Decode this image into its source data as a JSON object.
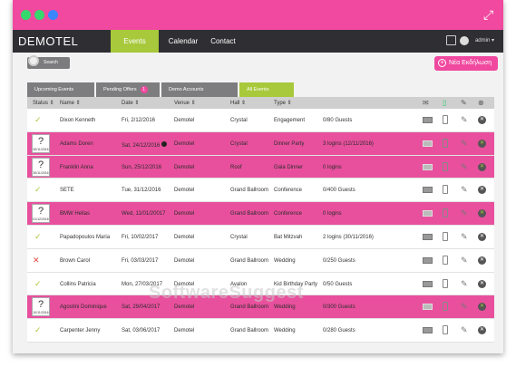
{
  "app": {
    "brand": "DEMOTEL"
  },
  "nav": {
    "tabs": [
      {
        "label": "Events"
      },
      {
        "label": "Calendar"
      },
      {
        "label": "Contact"
      }
    ],
    "user": "admin"
  },
  "toolbar": {
    "search_label": "Search",
    "new_event_label": "Νέα Εκδήλωση"
  },
  "filters": [
    {
      "label": "Upcoming Events"
    },
    {
      "label": "Pending Offers",
      "count": "1"
    },
    {
      "label": "Demo Accounts"
    },
    {
      "label": "All Events"
    }
  ],
  "table": {
    "headers": [
      "Status",
      "Name",
      "Date",
      "Venue",
      "Hall",
      "Type"
    ],
    "rows": [
      {
        "status": "check",
        "name": "Dixon Kenneth",
        "date": "Fri, 2/12/2016",
        "venue": "Demotel",
        "hall": "Crystal",
        "type": "Engagement",
        "guests": "0/80 Guests",
        "pink": false
      },
      {
        "status": "pending",
        "pending_date": "30/11/2016",
        "name": "Adams Doren",
        "date": "Sat, 24/12/2016",
        "venue": "Demotel",
        "hall": "Crystal",
        "type": "Dinner Party",
        "guests": "3 logins (12/11/2016)",
        "pink": true
      },
      {
        "status": "pending",
        "pending_date": "30/11/2016",
        "name": "Franklin Anna",
        "date": "Sun, 25/12/2016",
        "venue": "Demotel",
        "hall": "Roof",
        "type": "Gala Dinner",
        "guests": "0 logins",
        "pink": true
      },
      {
        "status": "check",
        "name": "SETE",
        "date": "Tue, 31/12/2016",
        "venue": "Demotel",
        "hall": "Grand Ballroom",
        "type": "Conference",
        "guests": "0/400 Guests",
        "pink": false
      },
      {
        "status": "pending",
        "pending_date": "01/12/2016",
        "name": "BMW Hellas",
        "date": "Wed, 11/01/20017",
        "venue": "Demotel",
        "hall": "Grand Ballroom",
        "type": "Conference",
        "guests": "0 logins",
        "pink": true
      },
      {
        "status": "check",
        "name": "Papadopoulos Maria",
        "date": "Fri, 10/02/2017",
        "venue": "Demotel",
        "hall": "Crystal",
        "type": "Bat Mitzvah",
        "guests": "2 logins (30/11/2016)",
        "pink": false
      },
      {
        "status": "cross",
        "name": "Brown Carol",
        "date": "Fri, 03/03/2017",
        "venue": "Demotel",
        "hall": "Grand Ballroom",
        "type": "Wedding",
        "guests": "0/250 Guests",
        "pink": false
      },
      {
        "status": "check",
        "name": "Collins Patricia",
        "date": "Mon, 27/03/2017",
        "venue": "Demotel",
        "hall": "Avalon",
        "type": "Kid Birthday Party",
        "guests": "0/50 Guests",
        "pink": false
      },
      {
        "status": "pending",
        "pending_date": "10/11/2016",
        "name": "Agostini Dominique",
        "date": "Sat, 29/04/2017",
        "venue": "Demotel",
        "hall": "Grand Ballroom",
        "type": "Wedding",
        "guests": "0/300 Guests",
        "pink": true
      },
      {
        "status": "check",
        "name": "Carpenter Jenny",
        "date": "Sat, 03/06/2017",
        "venue": "Demotel",
        "hall": "Grand Ballroom",
        "type": "Wedding",
        "guests": "0/280 Guests",
        "pink": false
      }
    ]
  },
  "watermark": "SoftwareSuggest",
  "colors": {
    "accent_pink": "#f0499f",
    "accent_green": "#a8c93b",
    "nav_dark": "#2f2f33"
  }
}
